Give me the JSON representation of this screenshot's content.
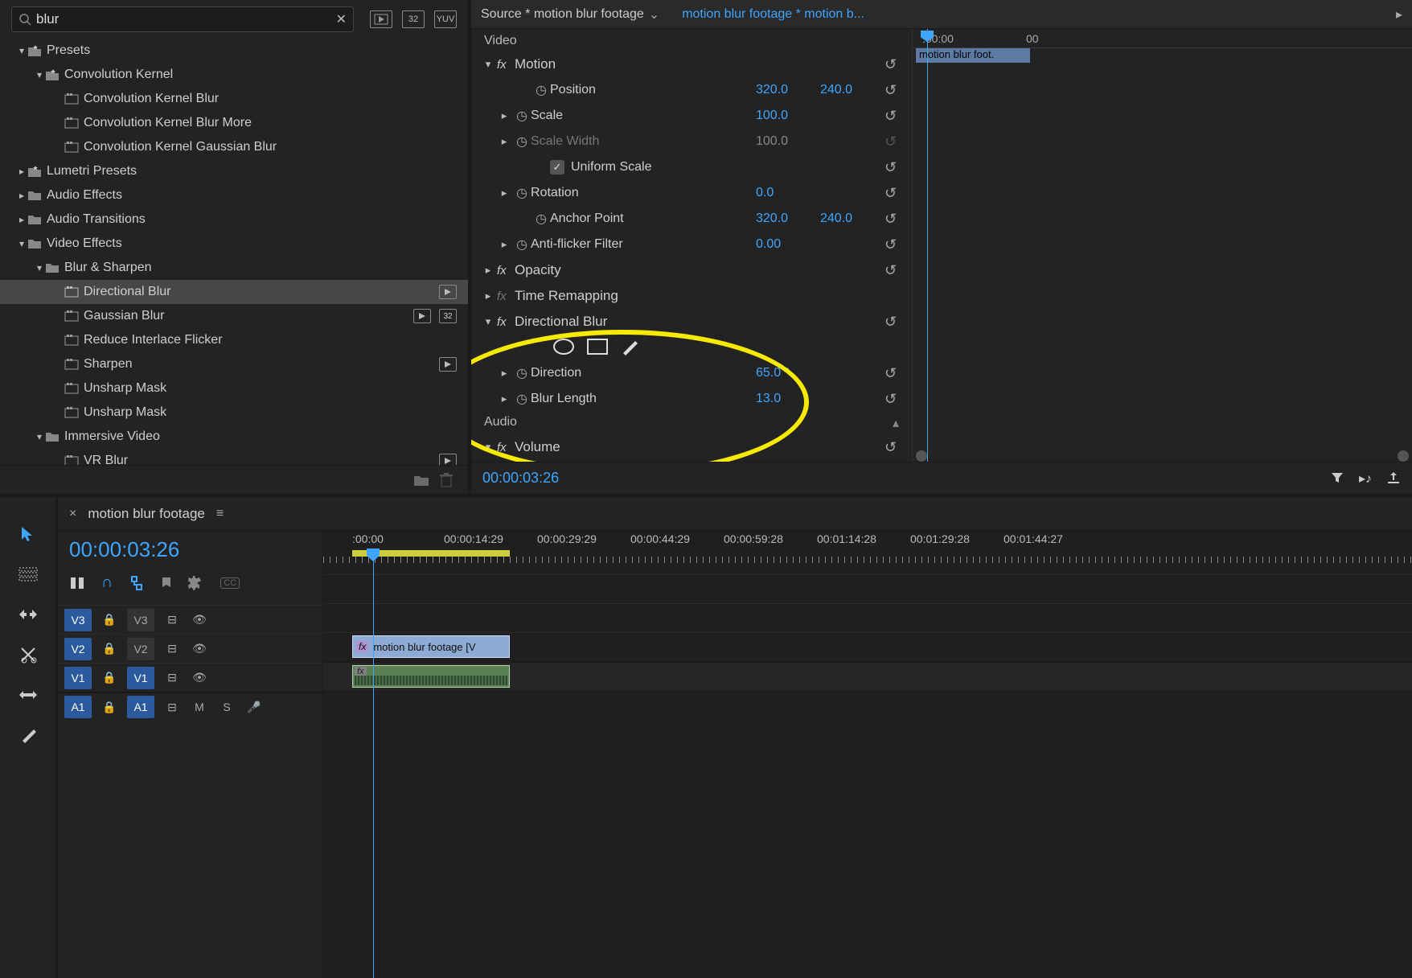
{
  "search": {
    "value": "blur"
  },
  "toolbar_icons": {
    "a": "⧉",
    "b": "32",
    "c": "YUV"
  },
  "tree": {
    "presets": "Presets",
    "convKernel": "Convolution Kernel",
    "ckBlur": "Convolution Kernel Blur",
    "ckBlurMore": "Convolution Kernel Blur More",
    "ckGauss": "Convolution Kernel Gaussian Blur",
    "lumetri": "Lumetri Presets",
    "audioFx": "Audio Effects",
    "audioTr": "Audio Transitions",
    "videoFx": "Video Effects",
    "blurSharpen": "Blur & Sharpen",
    "dirBlur": "Directional Blur",
    "gaussBlur": "Gaussian Blur",
    "reduceFlicker": "Reduce Interlace Flicker",
    "sharpen": "Sharpen",
    "unsharp1": "Unsharp Mask",
    "unsharp2": "Unsharp Mask",
    "immersive": "Immersive Video",
    "vrBlur": "VR Blur"
  },
  "effctl": {
    "source": "Source * motion blur footage",
    "sequence": "motion blur footage * motion b...",
    "ruler0": ":00:00",
    "ruler1": "00",
    "miniClip": "motion blur foot.",
    "video": "Video",
    "motion": "Motion",
    "position": "Position",
    "posX": "320.0",
    "posY": "240.0",
    "scale": "Scale",
    "scaleV": "100.0",
    "scaleW": "Scale Width",
    "scaleWV": "100.0",
    "uniform": "Uniform Scale",
    "rotation": "Rotation",
    "rotV": "0.0",
    "anchor": "Anchor Point",
    "anchX": "320.0",
    "anchY": "240.0",
    "antiFlicker": "Anti-flicker Filter",
    "antiV": "0.00",
    "opacity": "Opacity",
    "timeRemap": "Time Remapping",
    "dirBlur": "Directional Blur",
    "direction": "Direction",
    "dirV": "65.0 °",
    "blurLen": "Blur Length",
    "blurV": "13.0",
    "audio": "Audio",
    "volume": "Volume",
    "tc": "00:00:03:26"
  },
  "timeline": {
    "title": "motion blur footage",
    "tc": "00:00:03:26",
    "ticks": [
      ":00:00",
      "00:00:14:29",
      "00:00:29:29",
      "00:00:44:29",
      "00:00:59:28",
      "00:01:14:28",
      "00:01:29:28",
      "00:01:44:27"
    ],
    "v3": "V3",
    "v2": "V2",
    "v1": "V1",
    "a1": "A1",
    "m": "M",
    "s": "S",
    "clipV": "motion blur footage [V"
  }
}
